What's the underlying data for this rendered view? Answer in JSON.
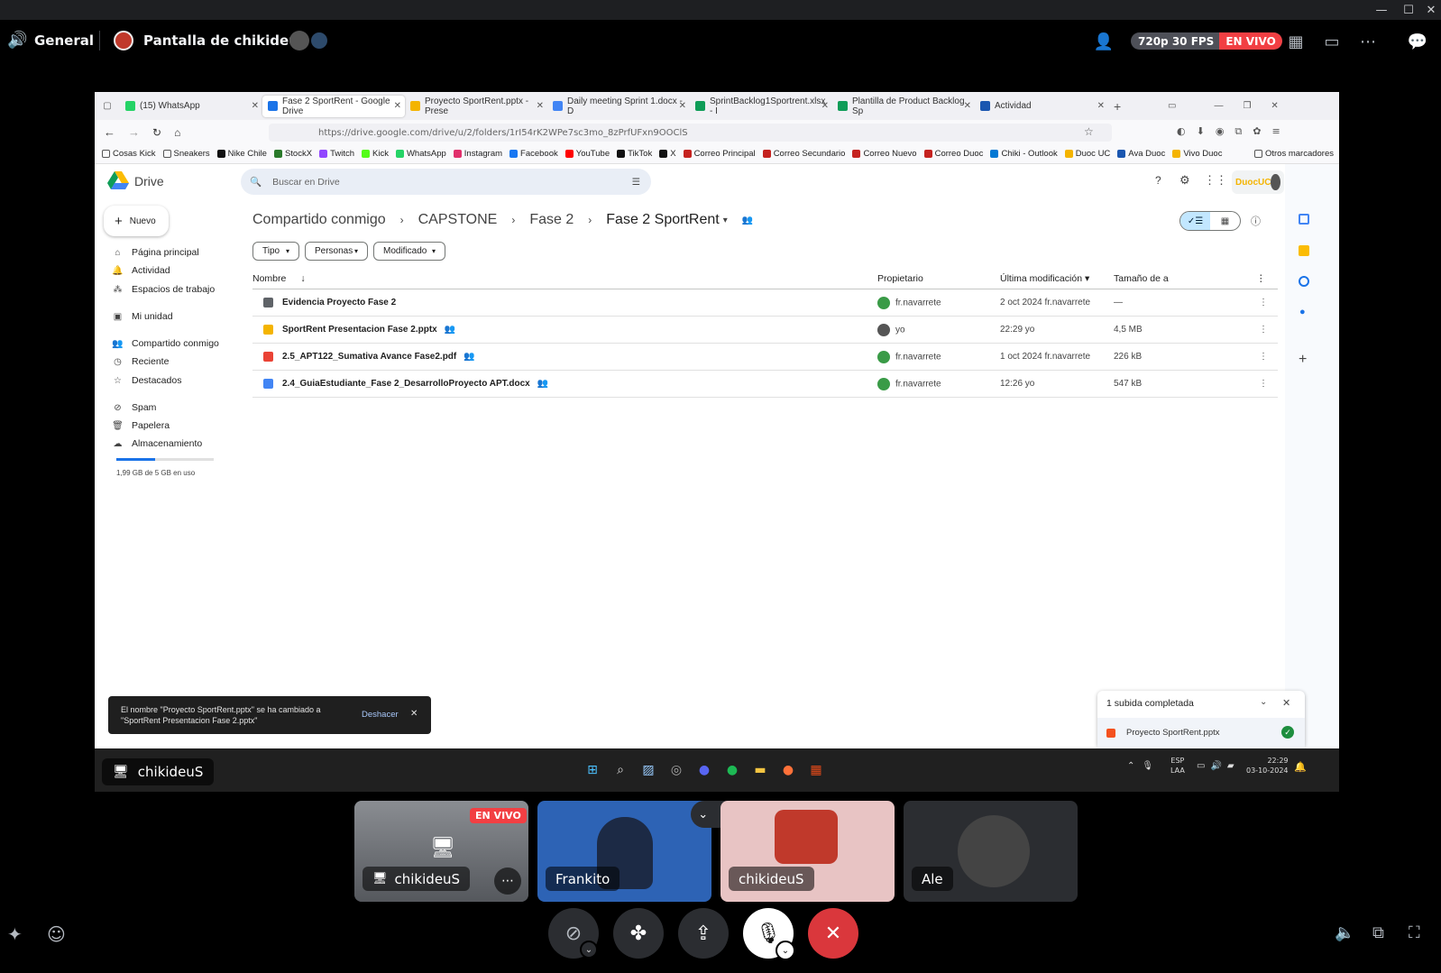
{
  "topbar": {
    "channel": "General",
    "stream_title": "Pantalla de chikideuS",
    "quality": "720p 30 FPS",
    "live": "EN VIVO"
  },
  "browser": {
    "tabs": [
      "(15) WhatsApp",
      "Fase 2 SportRent - Google Drive",
      "Proyecto SportRent.pptx - Prese",
      "Daily meeting Sprint 1.docx - D",
      "SprintBacklog1Sportrent.xlsx - I",
      "Plantilla de Product Backlog Sp",
      "Actividad"
    ],
    "url": "https://drive.google.com/drive/u/2/folders/1rI54rK2WPe7sc3mo_8zPrfUFxn9OOClS",
    "bookmarks": [
      "Cosas Kick",
      "Sneakers",
      "Nike Chile",
      "StockX",
      "Twitch",
      "Kick",
      "WhatsApp",
      "Instagram",
      "Facebook",
      "YouTube",
      "TikTok",
      "X",
      "Correo Principal",
      "Correo Secundario",
      "Correo Nuevo",
      "Correo Duoc",
      "Chiki - Outlook",
      "Duoc UC",
      "Ava Duoc",
      "Vivo Duoc"
    ],
    "other_bookmarks": "Otros marcadores"
  },
  "drive": {
    "logo": "Drive",
    "search_placeholder": "Buscar en Drive",
    "new_button": "Nuevo",
    "org": "DuocUC",
    "sidebar": [
      "Página principal",
      "Actividad",
      "Espacios de trabajo",
      "Mi unidad",
      "Compartido conmigo",
      "Reciente",
      "Destacados",
      "Spam",
      "Papelera",
      "Almacenamiento"
    ],
    "storage": "1,99 GB de 5 GB en uso",
    "storage_fraction": 0.398,
    "breadcrumb": [
      "Compartido conmigo",
      "CAPSTONE",
      "Fase 2",
      "Fase 2 SportRent"
    ],
    "filters": [
      "Tipo",
      "Personas",
      "Modificado"
    ],
    "headers": {
      "name": "Nombre",
      "owner": "Propietario",
      "modified": "Última modificación",
      "size": "Tamaño de a"
    },
    "files": [
      {
        "name": "Evidencia Proyecto Fase 2",
        "owner": "fr.navarrete",
        "modified": "2 oct 2024 fr.navarrete",
        "size": "—",
        "color": "#5f6368"
      },
      {
        "name": "SportRent Presentacion Fase 2.pptx",
        "owner": "yo",
        "modified": "22:29 yo",
        "size": "4,5 MB",
        "color": "#f4b400"
      },
      {
        "name": "2.5_APT122_Sumativa Avance Fase2.pdf",
        "owner": "fr.navarrete",
        "modified": "1 oct 2024 fr.navarrete",
        "size": "226 kB",
        "color": "#ea4335"
      },
      {
        "name": "2.4_GuiaEstudiante_Fase 2_DesarrolloProyecto APT.docx",
        "owner": "fr.navarrete",
        "modified": "12:26 yo",
        "size": "547 kB",
        "color": "#4285f4"
      }
    ],
    "toast": {
      "text1": "El nombre \"Proyecto SportRent.pptx\" se ha cambiado a",
      "text2": "\"SportRent Presentacion Fase 2.pptx\"",
      "undo": "Deshacer"
    },
    "upload": {
      "title": "1 subida completada",
      "file": "Proyecto SportRent.pptx"
    }
  },
  "taskbar": {
    "lang1": "ESP",
    "lang2": "LAA",
    "time": "22:29",
    "date": "03-10-2024"
  },
  "stream_label": "chikideuS",
  "tiles": [
    {
      "name": "chikideuS",
      "badge": "EN VIVO"
    },
    {
      "name": "Frankito"
    },
    {
      "name": "chikideuS"
    },
    {
      "name": "Ale"
    }
  ]
}
